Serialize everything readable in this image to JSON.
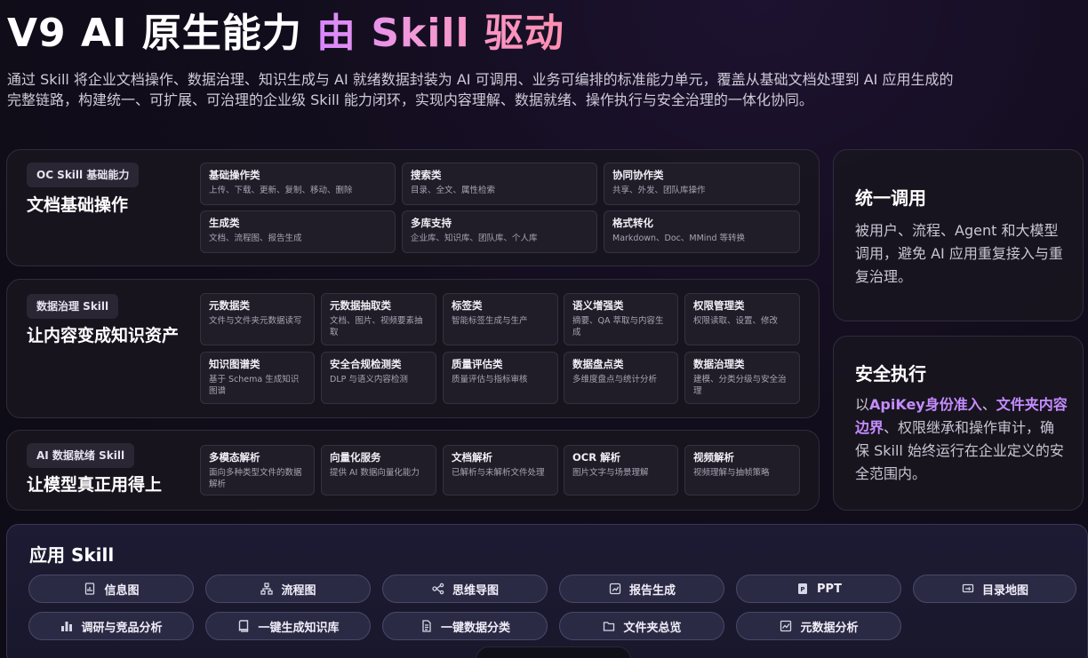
{
  "hero": {
    "title_prefix": "V9 AI 原生能力 ",
    "title_highlight": "由 Skill 驱动",
    "description": "通过 Skill 将企业文档操作、数据治理、知识生成与 AI 就绪数据封装为 AI 可调用、业务可编排的标准能力单元，覆盖从基础文档处理到 AI 应用生成的完整链路，构建统一、可扩展、可治理的企业级 Skill 能力闭环，实现内容理解、数据就绪、操作执行与安全治理的一体化协同。"
  },
  "categories": [
    {
      "tag": "OC Skill 基础能力",
      "title": "文档基础操作",
      "cards": [
        {
          "title": "基础操作类",
          "desc": "上传、下载、更新、复制、移动、删除"
        },
        {
          "title": "搜索类",
          "desc": "目录、全文、属性检索"
        },
        {
          "title": "协同协作类",
          "desc": "共享、外发、团队库操作"
        },
        {
          "title": "生成类",
          "desc": "文档、流程图、报告生成"
        },
        {
          "title": "多库支持",
          "desc": "企业库、知识库、团队库、个人库"
        },
        {
          "title": "格式转化",
          "desc": "Markdown、Doc、MMind 等转换"
        }
      ]
    },
    {
      "tag": "数据治理 Skill",
      "title": "让内容变成知识资产",
      "cards": [
        {
          "title": "元数据类",
          "desc": "文件与文件夹元数据读写"
        },
        {
          "title": "元数据抽取类",
          "desc": "文档、图片、视频要素抽取"
        },
        {
          "title": "标签类",
          "desc": "智能标签生成与生产"
        },
        {
          "title": "语义增强类",
          "desc": "摘要、QA 萃取与内容生成"
        },
        {
          "title": "权限管理类",
          "desc": "权限读取、设置、修改"
        },
        {
          "title": "知识图谱类",
          "desc": "基于 Schema 生成知识图谱"
        },
        {
          "title": "安全合规检测类",
          "desc": "DLP 与语义内容检测"
        },
        {
          "title": "质量评估类",
          "desc": "质量评估与指标审核"
        },
        {
          "title": "数据盘点类",
          "desc": "多维度盘点与统计分析"
        },
        {
          "title": "数据治理类",
          "desc": "建模、分类分级与安全治理"
        }
      ]
    },
    {
      "tag": "AI 数据就绪 Skill",
      "title": "让模型真正用得上",
      "cards": [
        {
          "title": "多模态解析",
          "desc": "面向多种类型文件的数据解析"
        },
        {
          "title": "向量化服务",
          "desc": "提供 AI 数据向量化能力"
        },
        {
          "title": "文档解析",
          "desc": "已解析与未解析文件处理"
        },
        {
          "title": "OCR 解析",
          "desc": "图片文字与场景理解"
        },
        {
          "title": "视频解析",
          "desc": "视频理解与抽帧策略"
        }
      ]
    }
  ],
  "side": [
    {
      "title": "统一调用",
      "body": "被用户、流程、Agent 和大模型调用，避免 AI 应用重复接入与重复治理。"
    },
    {
      "title": "安全执行",
      "body_pre": "以",
      "hl1": "ApiKey身份准入",
      "mid": "、",
      "hl2": "文件夹内容边界",
      "body_post": "、权限继承和操作审计，确保 Skill 始终运行在企业定义的安全范围内。"
    }
  ],
  "apps": {
    "title": "应用 Skill",
    "chips": [
      {
        "label": "信息图",
        "icon": "infographic-icon"
      },
      {
        "label": "流程图",
        "icon": "flowchart-icon"
      },
      {
        "label": "思维导图",
        "icon": "mindmap-icon"
      },
      {
        "label": "报告生成",
        "icon": "report-icon"
      },
      {
        "label": "PPT",
        "icon": "ppt-icon"
      },
      {
        "label": "目录地图",
        "icon": "directory-map-icon"
      },
      {
        "label": "调研与竞品分析",
        "icon": "bar-chart-icon"
      },
      {
        "label": "一键生成知识库",
        "icon": "book-icon"
      },
      {
        "label": "一键数据分类",
        "icon": "document-icon"
      },
      {
        "label": "文件夹总览",
        "icon": "folder-icon"
      },
      {
        "label": "元数据分析",
        "icon": "line-chart-icon"
      }
    ]
  },
  "colors": {
    "accent": "#c58cff",
    "title_gradient_start": "#d986ff",
    "title_gradient_end": "#ff8fae"
  }
}
